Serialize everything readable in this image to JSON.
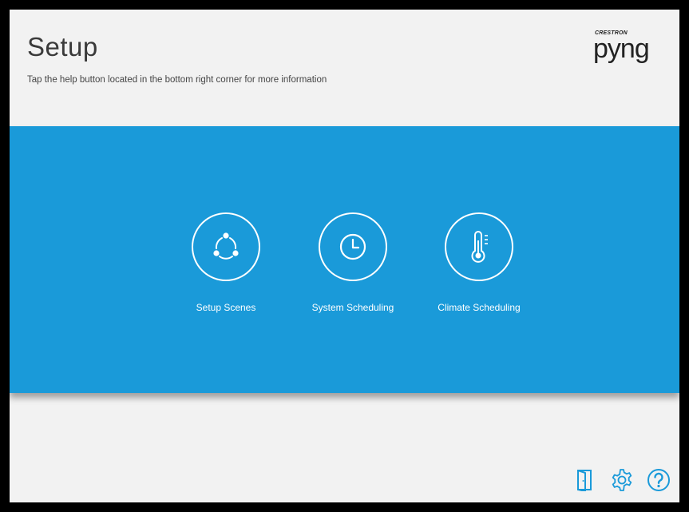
{
  "header": {
    "title": "Setup",
    "subtitle": "Tap the help button located in the bottom right corner for more information"
  },
  "logo": {
    "brand_small": "CRESTRON",
    "brand_main": "pyng"
  },
  "tiles": [
    {
      "label": "Setup Scenes",
      "icon": "scenes-icon"
    },
    {
      "label": "System Scheduling",
      "icon": "clock-icon"
    },
    {
      "label": "Climate Scheduling",
      "icon": "thermometer-icon"
    }
  ],
  "bottom_bar": {
    "icons": [
      "door-icon",
      "gear-icon",
      "help-icon"
    ]
  },
  "colors": {
    "accent": "#1a9ad9",
    "background": "#f2f2f2",
    "icon": "#1a9ad9"
  }
}
